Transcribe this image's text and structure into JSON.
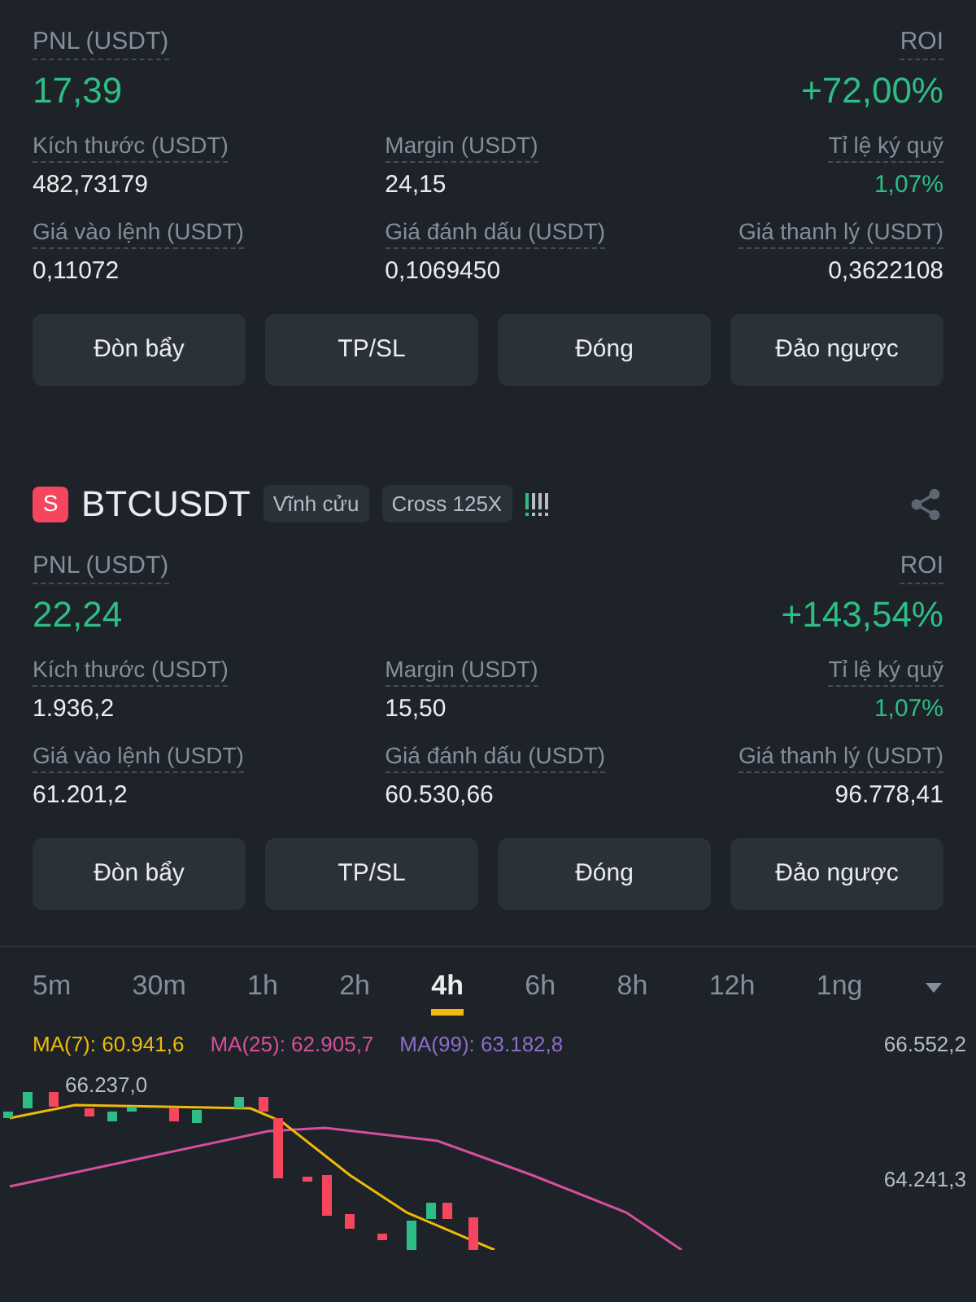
{
  "positions": [
    {
      "pnl_label": "PNL (USDT)",
      "pnl": "17,39",
      "roi_label": "ROI",
      "roi": "+72,00%",
      "fields": [
        {
          "label": "Kích thước (USDT)",
          "value": "482,73179",
          "kind": "plain"
        },
        {
          "label": "Margin (USDT)",
          "value": "24,15",
          "kind": "plain"
        },
        {
          "label": "Tỉ lệ ký quỹ",
          "value": "1,07%",
          "kind": "positive"
        },
        {
          "label": "Giá vào lệnh (USDT)",
          "value": "0,11072",
          "kind": "plain"
        },
        {
          "label": "Giá đánh dấu (USDT)",
          "value": "0,1069450",
          "kind": "plain"
        },
        {
          "label": "Giá thanh lý (USDT)",
          "value": "0,3622108",
          "kind": "plain"
        }
      ],
      "buttons": [
        "Đòn bẩy",
        "TP/SL",
        "Đóng",
        "Đảo ngược"
      ]
    },
    {
      "symbol": {
        "side": "S",
        "name": "BTCUSDT",
        "tags": [
          "Vĩnh cửu",
          "Cross 125X"
        ]
      },
      "pnl_label": "PNL (USDT)",
      "pnl": "22,24",
      "roi_label": "ROI",
      "roi": "+143,54%",
      "fields": [
        {
          "label": "Kích thước (USDT)",
          "value": "1.936,2",
          "kind": "plain"
        },
        {
          "label": "Margin (USDT)",
          "value": "15,50",
          "kind": "plain"
        },
        {
          "label": "Tỉ lệ ký quỹ",
          "value": "1,07%",
          "kind": "positive"
        },
        {
          "label": "Giá vào lệnh (USDT)",
          "value": "61.201,2",
          "kind": "plain"
        },
        {
          "label": "Giá đánh dấu (USDT)",
          "value": "60.530,66",
          "kind": "plain"
        },
        {
          "label": "Giá thanh lý (USDT)",
          "value": "96.778,41",
          "kind": "plain"
        }
      ],
      "buttons": [
        "Đòn bẩy",
        "TP/SL",
        "Đóng",
        "Đảo ngược"
      ]
    }
  ],
  "intervals": [
    {
      "label": "5m",
      "selected": false
    },
    {
      "label": "30m",
      "selected": false
    },
    {
      "label": "1h",
      "selected": false
    },
    {
      "label": "2h",
      "selected": false
    },
    {
      "label": "4h",
      "selected": true
    },
    {
      "label": "6h",
      "selected": false
    },
    {
      "label": "8h",
      "selected": false
    },
    {
      "label": "12h",
      "selected": false
    },
    {
      "label": "1ng",
      "selected": false
    }
  ],
  "moving_averages": [
    {
      "label": "MA(7): 60.941,6",
      "color": "#f0b90b"
    },
    {
      "label": "MA(25): 62.905,7",
      "color": "#d64f9e"
    },
    {
      "label": "MA(99): 63.182,8",
      "color": "#8e6cc9"
    }
  ],
  "chart": {
    "high_label": "66.237,0",
    "price_labels": [
      "66.552,2",
      "64.241,3"
    ]
  }
}
